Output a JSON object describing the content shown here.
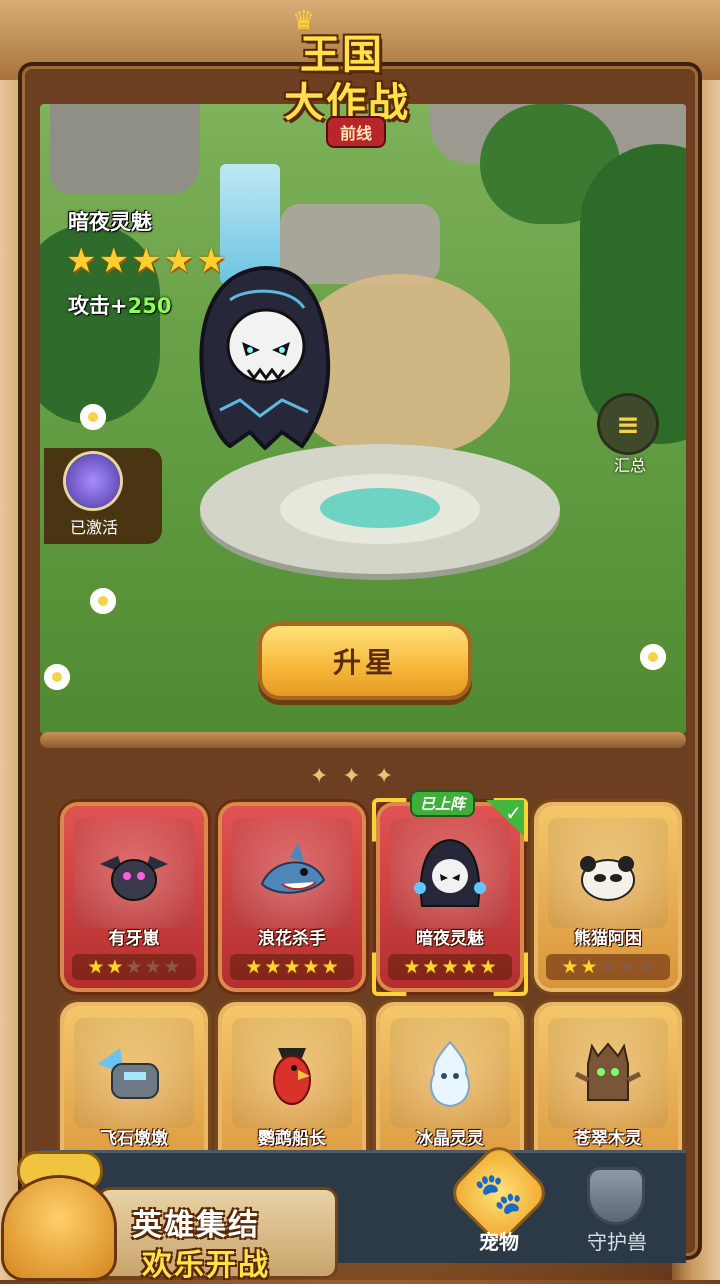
{
  "logo": {
    "line1": "王国",
    "line2": "大作战",
    "subtitle": "前线"
  },
  "pet_detail": {
    "name": "暗夜灵魅",
    "stars": 5,
    "attack_label": "攻击+",
    "attack_value": "250",
    "activated_label": "已激活",
    "summary_label": "汇总",
    "upstar_button": "升星"
  },
  "pets": [
    {
      "name": "有牙崽",
      "stars": 2,
      "max_stars": 5,
      "rarity": "red",
      "selected": false,
      "icon": "black-dragon-icon"
    },
    {
      "name": "浪花杀手",
      "stars": 5,
      "max_stars": 5,
      "rarity": "red",
      "selected": false,
      "icon": "shark-icon"
    },
    {
      "name": "暗夜灵魅",
      "stars": 5,
      "max_stars": 5,
      "rarity": "red",
      "selected": true,
      "badge": "已上阵",
      "icon": "reaper-icon"
    },
    {
      "name": "熊猫阿困",
      "stars": 2,
      "max_stars": 5,
      "rarity": "gold",
      "selected": false,
      "icon": "panda-icon"
    },
    {
      "name": "飞石墩墩",
      "rarity": "gold",
      "icon": "stone-golem-icon"
    },
    {
      "name": "鹦鹉船长",
      "rarity": "gold",
      "icon": "parrot-icon"
    },
    {
      "name": "冰晶灵灵",
      "rarity": "gold",
      "icon": "ice-spirit-icon"
    },
    {
      "name": "苍翠木灵",
      "rarity": "gold",
      "icon": "treant-icon"
    }
  ],
  "tabs": {
    "pet_label": "宠物",
    "guard_label": "守护兽"
  },
  "ad": {
    "line1": "英雄集结",
    "line2": "欢乐开战"
  },
  "colors": {
    "star_on": "#ffd42e",
    "star_off": "#8b5a44",
    "attack_value": "#8dff5a",
    "on_team_badge": "#3fae3a"
  }
}
